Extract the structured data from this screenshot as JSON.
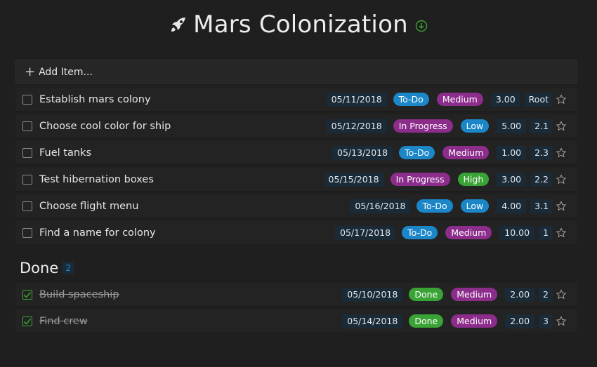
{
  "header": {
    "title": "Mars Colonization",
    "icon": "rocket-icon",
    "download_icon": "download-icon",
    "accent": "#3aa335"
  },
  "add_item": {
    "label": "Add Item..."
  },
  "todo_items": [
    {
      "name": "Establish mars colony",
      "date": "05/11/2018",
      "status": "To-Do",
      "priority": "Medium",
      "estimate": "3.00",
      "rank": "Root"
    },
    {
      "name": "Choose cool color for ship",
      "date": "05/12/2018",
      "status": "In Progress",
      "priority": "Low",
      "estimate": "5.00",
      "rank": "2.1"
    },
    {
      "name": "Fuel tanks",
      "date": "05/13/2018",
      "status": "To-Do",
      "priority": "Medium",
      "estimate": "1.00",
      "rank": "2.3"
    },
    {
      "name": "Test hibernation boxes",
      "date": "05/15/2018",
      "status": "In Progress",
      "priority": "High",
      "estimate": "3.00",
      "rank": "2.2"
    },
    {
      "name": "Choose flight menu",
      "date": "05/16/2018",
      "status": "To-Do",
      "priority": "Low",
      "estimate": "4.00",
      "rank": "3.1"
    },
    {
      "name": "Find a name for colony",
      "date": "05/17/2018",
      "status": "To-Do",
      "priority": "Medium",
      "estimate": "10.00",
      "rank": "1"
    }
  ],
  "done_section": {
    "label": "Done",
    "count": "2"
  },
  "done_items": [
    {
      "name": "Build spaceship",
      "date": "05/10/2018",
      "status": "Done",
      "priority": "Medium",
      "estimate": "2.00",
      "rank": "2"
    },
    {
      "name": "Find crew",
      "date": "05/14/2018",
      "status": "Done",
      "priority": "Medium",
      "estimate": "2.00",
      "rank": "3"
    }
  ],
  "colors": {
    "background": "#1f1f1f",
    "todo_blue": "#1b87c9",
    "progress_purple": "#8c2d8c",
    "done_green": "#3aa335"
  }
}
